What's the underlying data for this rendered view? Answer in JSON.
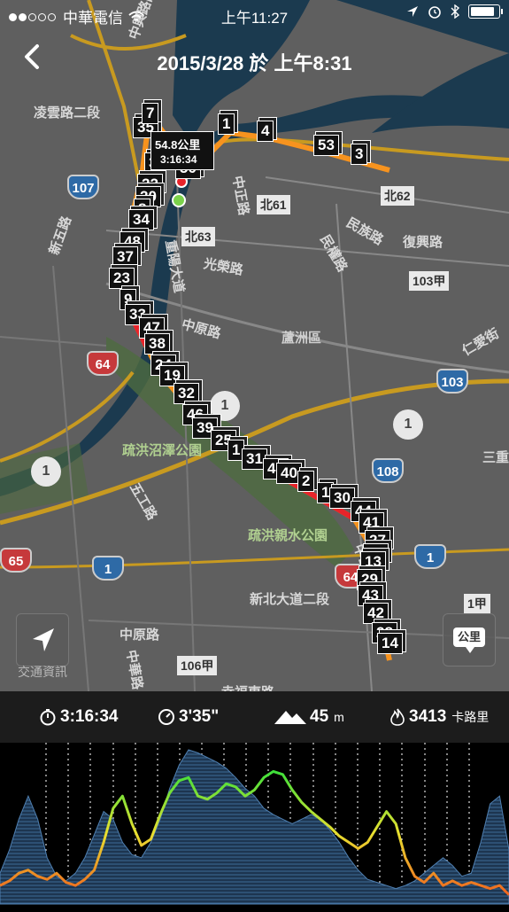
{
  "status_bar": {
    "carrier": "中華電信",
    "time": "上午11:27",
    "battery_level": 0.9
  },
  "nav": {
    "title": "2015/3/28 於 上午8:31"
  },
  "map": {
    "callout": {
      "distance": "54.8公里",
      "time": "3:16:34"
    },
    "km_markers": [
      {
        "label": "35"
      },
      {
        "label": "7"
      },
      {
        "label": "3"
      },
      {
        "label": "22"
      },
      {
        "label": "20"
      },
      {
        "label": "8"
      },
      {
        "label": "34"
      },
      {
        "label": "48"
      },
      {
        "label": "37"
      },
      {
        "label": "23"
      },
      {
        "label": "9"
      },
      {
        "label": "33"
      },
      {
        "label": "47"
      },
      {
        "label": "38"
      },
      {
        "label": "24"
      },
      {
        "label": "19"
      },
      {
        "label": "32"
      },
      {
        "label": "46"
      },
      {
        "label": "39"
      },
      {
        "label": "25"
      },
      {
        "label": "1"
      },
      {
        "label": "31"
      },
      {
        "label": "45"
      },
      {
        "label": "40"
      },
      {
        "label": "2"
      },
      {
        "label": "1"
      },
      {
        "label": "30"
      },
      {
        "label": "44"
      },
      {
        "label": "41"
      },
      {
        "label": "27"
      },
      {
        "label": "15"
      },
      {
        "label": "13"
      },
      {
        "label": "29"
      },
      {
        "label": "43"
      },
      {
        "label": "42"
      },
      {
        "label": "28"
      },
      {
        "label": "14"
      },
      {
        "label": "50"
      },
      {
        "label": "1"
      },
      {
        "label": "4"
      },
      {
        "label": "53"
      },
      {
        "label": "3"
      }
    ],
    "road_labels": {
      "r1": "凌雲路二段",
      "r2": "中興路四段",
      "r3": "中正路",
      "r4": "民族路",
      "r5": "復興路",
      "r6": "民權路",
      "r7": "光榮路",
      "r8": "中原路",
      "r9": "蘆洲區",
      "r10": "疏洪沼澤公園",
      "r11": "疏洪親水公園",
      "r12": "中山路",
      "r13": "新北大道二段",
      "r14": "中原路",
      "r15": "五工路",
      "r16": "新五路",
      "r17": "仁愛街",
      "r18": "三重",
      "r19": "幸福東路",
      "r20": "中華路",
      "r21": "中山路",
      "r22": "環河路",
      "r23": "重陽大道"
    },
    "route_labels": {
      "n61": "北61",
      "n62": "北62",
      "n63": "北63",
      "b103a": "103甲",
      "b106a": "106甲",
      "b1a": "1甲"
    },
    "shields": {
      "s107": "107",
      "s64a": "64",
      "s103": "103",
      "s108": "108",
      "s1a": "1",
      "s1b": "1",
      "s64b": "64",
      "s65": "65",
      "f1a": "1",
      "f1b": "1",
      "f1c": "1"
    },
    "unit_button": "公里",
    "traffic_label": "交通資訊"
  },
  "stats": {
    "duration": "3:16:34",
    "pace": "3'35\"",
    "elevation": "45",
    "elevation_unit": "m",
    "calories": "3413",
    "calories_unit": "卡路里"
  },
  "colors": {
    "route_fast": "#f7931e",
    "route_slow": "#e8232a",
    "chart_line_high": "#3ee03a",
    "chart_line_low": "#f0631e",
    "elevation_fill": "#2c4a6e"
  },
  "chart_data": {
    "type": "area",
    "x": [
      0,
      1,
      2,
      3,
      4,
      5,
      6,
      7,
      8,
      9,
      10,
      11,
      12,
      13,
      14,
      15,
      16,
      17,
      18,
      19,
      20,
      21,
      22,
      23,
      24,
      25,
      26,
      27,
      28,
      29,
      30,
      31,
      32,
      33,
      34,
      35,
      36,
      37,
      38,
      39,
      40,
      41,
      42,
      43,
      44,
      45,
      46,
      47,
      48,
      49,
      50,
      51,
      52,
      53,
      54
    ],
    "series": [
      {
        "values": [
          20,
          35,
          55,
          70,
          55,
          30,
          18,
          15,
          20,
          30,
          45,
          60,
          55,
          40,
          32,
          30,
          40,
          55,
          75,
          90,
          100,
          98,
          95,
          92,
          88,
          82,
          75,
          70,
          62,
          58,
          55,
          52,
          55,
          58,
          55,
          48,
          40,
          30,
          22,
          16,
          14,
          12,
          10,
          12,
          15,
          20,
          25,
          30,
          25,
          18,
          20,
          40,
          65,
          70,
          35
        ]
      },
      {
        "values": [
          12,
          15,
          20,
          22,
          18,
          16,
          20,
          14,
          12,
          16,
          22,
          40,
          62,
          70,
          52,
          38,
          42,
          58,
          72,
          80,
          82,
          70,
          68,
          72,
          78,
          76,
          70,
          74,
          82,
          86,
          84,
          74,
          66,
          60,
          55,
          50,
          44,
          40,
          36,
          40,
          50,
          60,
          52,
          30,
          18,
          14,
          20,
          12,
          15,
          12,
          14,
          12,
          10,
          12,
          6
        ]
      }
    ],
    "grid": true
  }
}
